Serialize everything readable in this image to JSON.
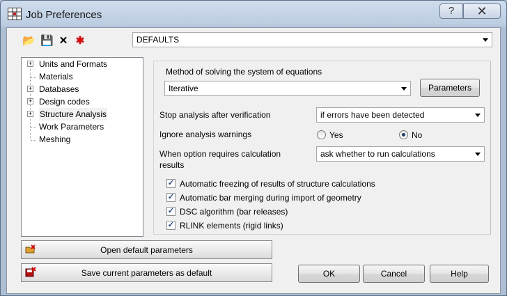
{
  "window": {
    "title": "Job Preferences",
    "help_glyph": "?",
    "close_glyph": "✕"
  },
  "toolbar": {
    "open_glyph": "📂",
    "save_glyph": "💾",
    "delete_glyph": "✕",
    "default_glyph": "✱"
  },
  "profile_select": {
    "value": "DEFAULTS"
  },
  "tree": {
    "items": [
      {
        "label": "Units and Formats",
        "expandable": true
      },
      {
        "label": "Materials",
        "expandable": false
      },
      {
        "label": "Databases",
        "expandable": true
      },
      {
        "label": "Design codes",
        "expandable": true
      },
      {
        "label": "Structure Analysis",
        "expandable": true
      },
      {
        "label": "Work Parameters",
        "expandable": false
      },
      {
        "label": "Meshing",
        "expandable": false
      }
    ],
    "expander_glyph": "+"
  },
  "analysis": {
    "method_label": "Method of solving the system of equations",
    "method_value": "Iterative",
    "parameters_button": "Parameters",
    "stop_label": "Stop analysis after verification",
    "stop_value": "if errors have been detected",
    "ignore_label": "Ignore analysis warnings",
    "yes_label": "Yes",
    "no_label": "No",
    "requires_label_1": "When option requires calculation",
    "requires_label_2": "results",
    "requires_value": "ask whether to run calculations",
    "checkboxes": [
      {
        "label": "Automatic freezing of results of structure calculations",
        "checked": true
      },
      {
        "label": "Automatic bar merging during import of geometry",
        "checked": true
      },
      {
        "label": "DSC algorithm (bar releases)",
        "checked": true
      },
      {
        "label": "RLINK elements (rigid links)",
        "checked": true
      }
    ],
    "check_glyph": "✓"
  },
  "footer": {
    "open_default": "Open default parameters",
    "save_default": "Save current parameters as default",
    "ok": "OK",
    "cancel": "Cancel",
    "help": "Help"
  }
}
